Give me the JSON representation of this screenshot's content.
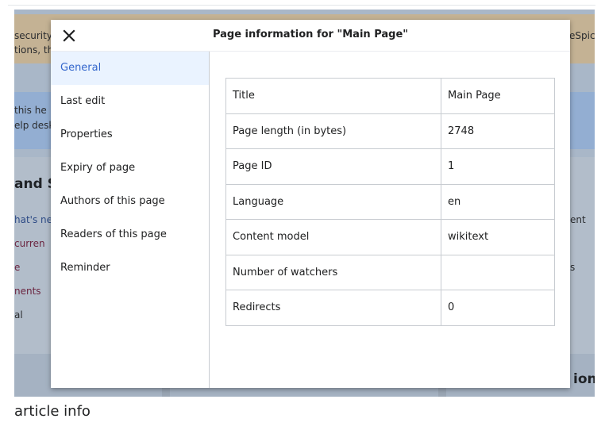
{
  "background": {
    "fragments": [
      "security",
      "tions, th",
      "eSpice",
      "this he",
      "elp desk",
      "and S",
      "hat's ne",
      "curren",
      "e",
      "nents",
      "al",
      "ent",
      "s",
      "ion"
    ]
  },
  "caption": "article info",
  "dialog": {
    "title": "Page information for \"Main Page\"",
    "close_icon": "close-icon",
    "nav": [
      {
        "label": "General",
        "active": true
      },
      {
        "label": "Last edit"
      },
      {
        "label": "Properties"
      },
      {
        "label": "Expiry of page"
      },
      {
        "label": "Authors of this page"
      },
      {
        "label": "Readers of this page"
      },
      {
        "label": "Reminder"
      }
    ],
    "table": [
      {
        "key": "Title",
        "value": "Main Page"
      },
      {
        "key": "Page length (in bytes)",
        "value": "2748"
      },
      {
        "key": "Page ID",
        "value": "1"
      },
      {
        "key": "Language",
        "value": "en"
      },
      {
        "key": "Content model",
        "value": "wikitext"
      },
      {
        "key": "Number of watchers",
        "value": ""
      },
      {
        "key": "Redirects",
        "value": "0"
      }
    ]
  },
  "colors": {
    "accent": "#3366cc",
    "active_bg": "#eaf3ff",
    "border": "#c8ccd1"
  }
}
